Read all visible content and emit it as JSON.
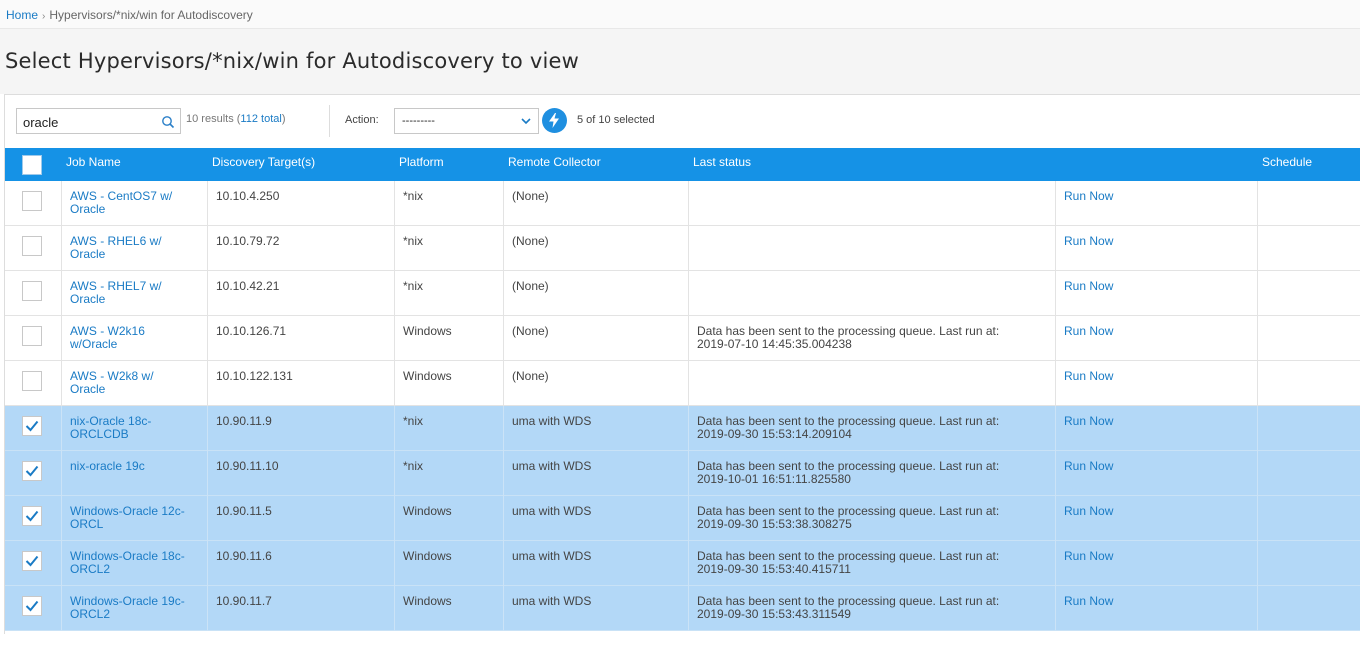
{
  "breadcrumb": {
    "home": "Home",
    "current": "Hypervisors/*nix/win for Autodiscovery"
  },
  "page_title": "Select Hypervisors/*nix/win for Autodiscovery to view",
  "search": {
    "value": "oracle",
    "icon": "search-icon"
  },
  "results": {
    "prefix": "10 results (",
    "total": "112 total",
    "suffix": ")"
  },
  "action": {
    "label": "Action:",
    "value": "---------",
    "icon": "chevron-down-icon"
  },
  "selected_count": "5 of 10 selected",
  "colors": {
    "header_bg": "#1592e6",
    "selected_row": "#b3d8f7",
    "link": "#1a7bc5"
  },
  "columns": [
    "Job Name",
    "Discovery Target(s)",
    "Platform",
    "Remote Collector",
    "Last status",
    "Schedule"
  ],
  "rows": [
    {
      "checked": false,
      "job_name_1": "AWS - CentOS7 w/",
      "job_name_2": "Oracle",
      "target": "10.10.4.250",
      "platform": "*nix",
      "collector": "(None)",
      "status_1": "",
      "status_2": "",
      "action": "Run Now"
    },
    {
      "checked": false,
      "job_name_1": "AWS - RHEL6 w/",
      "job_name_2": "Oracle",
      "target": "10.10.79.72",
      "platform": "*nix",
      "collector": "(None)",
      "status_1": "",
      "status_2": "",
      "action": "Run Now"
    },
    {
      "checked": false,
      "job_name_1": "AWS - RHEL7 w/",
      "job_name_2": "Oracle",
      "target": "10.10.42.21",
      "platform": "*nix",
      "collector": "(None)",
      "status_1": "",
      "status_2": "",
      "action": "Run Now"
    },
    {
      "checked": false,
      "job_name_1": "AWS - W2k16",
      "job_name_2": "w/Oracle",
      "target": "10.10.126.71",
      "platform": "Windows",
      "collector": "(None)",
      "status_1": "Data has been sent to the processing queue. Last run at:",
      "status_2": "2019-07-10 14:45:35.004238",
      "action": "Run Now"
    },
    {
      "checked": false,
      "job_name_1": "AWS - W2k8 w/",
      "job_name_2": "Oracle",
      "target": "10.10.122.131",
      "platform": "Windows",
      "collector": "(None)",
      "status_1": "",
      "status_2": "",
      "action": "Run Now"
    },
    {
      "checked": true,
      "job_name_1": "nix-Oracle 18c-",
      "job_name_2": "ORCLCDB",
      "target": "10.90.11.9",
      "platform": "*nix",
      "collector": "uma with WDS",
      "status_1": "Data has been sent to the processing queue. Last run at:",
      "status_2": "2019-09-30 15:53:14.209104",
      "action": "Run Now"
    },
    {
      "checked": true,
      "job_name_1": "nix-oracle 19c",
      "job_name_2": "",
      "target": "10.90.11.10",
      "platform": "*nix",
      "collector": "uma with WDS",
      "status_1": "Data has been sent to the processing queue. Last run at:",
      "status_2": "2019-10-01 16:51:11.825580",
      "action": "Run Now"
    },
    {
      "checked": true,
      "job_name_1": "Windows-Oracle 12c-",
      "job_name_2": "ORCL",
      "target": "10.90.11.5",
      "platform": "Windows",
      "collector": "uma with WDS",
      "status_1": "Data has been sent to the processing queue. Last run at:",
      "status_2": "2019-09-30 15:53:38.308275",
      "action": "Run Now"
    },
    {
      "checked": true,
      "job_name_1": "Windows-Oracle 18c-",
      "job_name_2": "ORCL2",
      "target": "10.90.11.6",
      "platform": "Windows",
      "collector": "uma with WDS",
      "status_1": "Data has been sent to the processing queue. Last run at:",
      "status_2": "2019-09-30 15:53:40.415711",
      "action": "Run Now"
    },
    {
      "checked": true,
      "job_name_1": "Windows-Oracle 19c-",
      "job_name_2": "ORCL2",
      "target": "10.90.11.7",
      "platform": "Windows",
      "collector": "uma with WDS",
      "status_1": "Data has been sent to the processing queue. Last run at:",
      "status_2": "2019-09-30 15:53:43.311549",
      "action": "Run Now"
    }
  ]
}
